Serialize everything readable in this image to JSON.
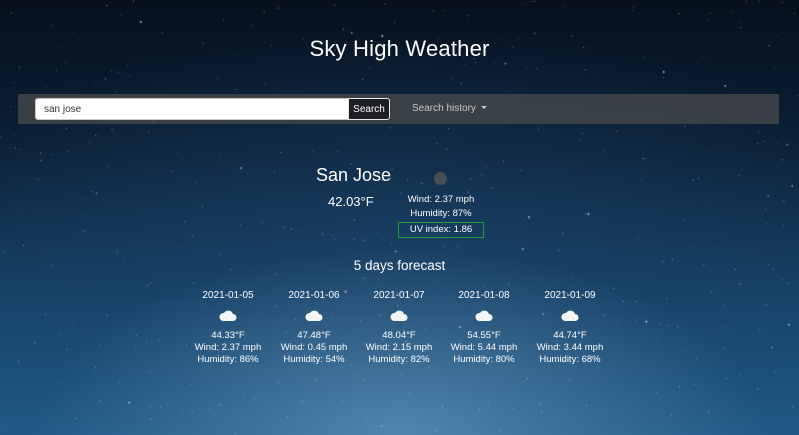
{
  "app": {
    "title": "Sky High Weather"
  },
  "search": {
    "value": "san jose",
    "button_label": "Search"
  },
  "history": {
    "label": "Search history"
  },
  "current": {
    "city": "San Jose",
    "temp": "42.03°F",
    "wind": "Wind: 2.37 mph",
    "humidity": "Humidity: 87%",
    "uv": "UV index: 1.86",
    "uv_color": "#1f9d3a",
    "icon": "weather-icon"
  },
  "forecast": {
    "heading": "5 days forecast",
    "icon": "cloud-icon",
    "days": [
      {
        "date": "2021-01-05",
        "temp": "44.33°F",
        "wind": "Wind: 2.37 mph",
        "humidity": "Humidity: 86%"
      },
      {
        "date": "2021-01-06",
        "temp": "47.48°F",
        "wind": "Wind: 0.45 mph",
        "humidity": "Humidity: 54%"
      },
      {
        "date": "2021-01-07",
        "temp": "48.04°F",
        "wind": "Wind: 2.15 mph",
        "humidity": "Humidity: 82%"
      },
      {
        "date": "2021-01-08",
        "temp": "54.55°F",
        "wind": "Wind: 5.44 mph",
        "humidity": "Humidity: 80%"
      },
      {
        "date": "2021-01-09",
        "temp": "44.74°F",
        "wind": "Wind: 3.44 mph",
        "humidity": "Humidity: 68%"
      }
    ]
  }
}
